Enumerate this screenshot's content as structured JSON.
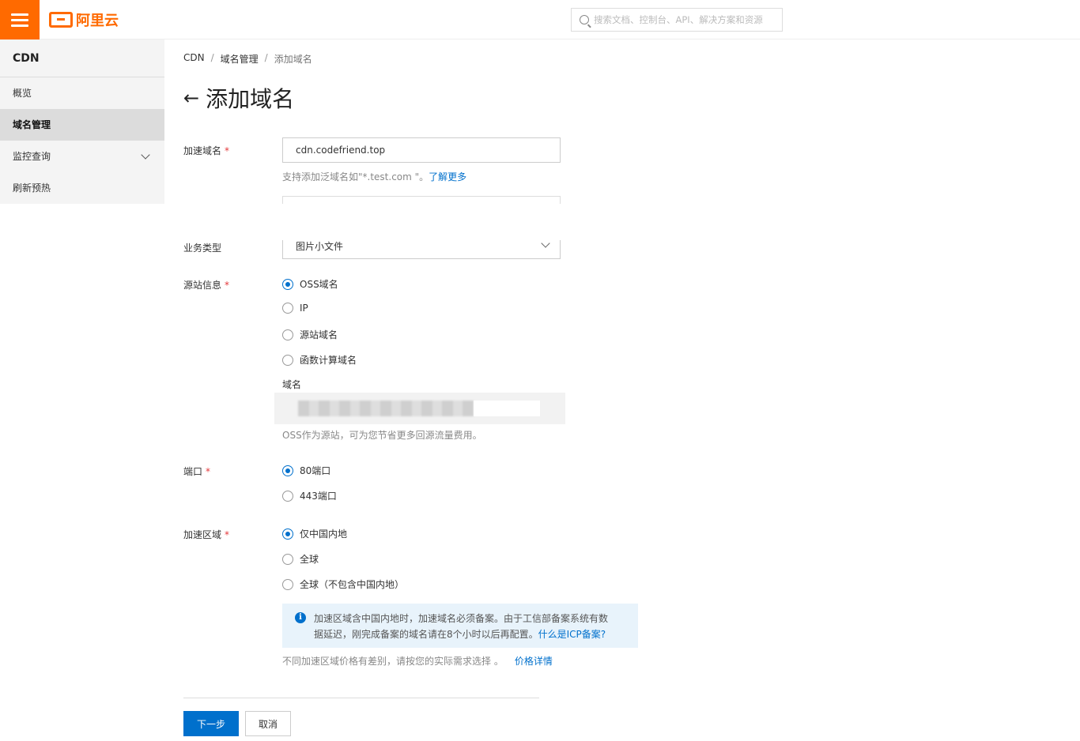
{
  "header": {
    "logo_text": "阿里云",
    "search_placeholder": "搜索文档、控制台、API、解决方案和资源"
  },
  "sidebar": {
    "title": "CDN",
    "items": [
      {
        "label": "概览"
      },
      {
        "label": "域名管理"
      },
      {
        "label": "监控查询"
      },
      {
        "label": "刷新预热"
      }
    ]
  },
  "breadcrumb": [
    "CDN",
    "域名管理",
    "添加域名"
  ],
  "page_title": "添加域名",
  "form": {
    "domain_label": "加速域名",
    "domain_value": "cdn.codefriend.top",
    "domain_hint": "支持添加泛域名如\"*.test.com \"。",
    "domain_hint_link": "了解更多",
    "business_type_label": "业务类型",
    "business_type_value": "图片小文件",
    "origin_label": "源站信息",
    "origin_options": [
      "OSS域名",
      "IP",
      "源站域名",
      "函数计算域名"
    ],
    "origin_domain_label": "域名",
    "origin_hint": "OSS作为源站，可为您节省更多回源流量费用。",
    "port_label": "端口",
    "port_options": [
      "80端口",
      "443端口"
    ],
    "region_label": "加速区域",
    "region_options": [
      "仅中国内地",
      "全球",
      "全球（不包含中国内地）"
    ],
    "notice_text_1": "加速区域含中国内地时，加速域名必须备案。由于工信部备案系统有数",
    "notice_text_2": "据延迟，刚完成备案的域名请在8个小时以后再配置。",
    "notice_link": "什么是ICP备案?",
    "price_hint": "不同加速区域价格有差别，请按您的实际需求选择 。",
    "price_link": "价格详情"
  },
  "buttons": {
    "next": "下一步",
    "cancel": "取消"
  },
  "colors": {
    "brand": "#ff6a00",
    "primary": "#0070cc"
  }
}
